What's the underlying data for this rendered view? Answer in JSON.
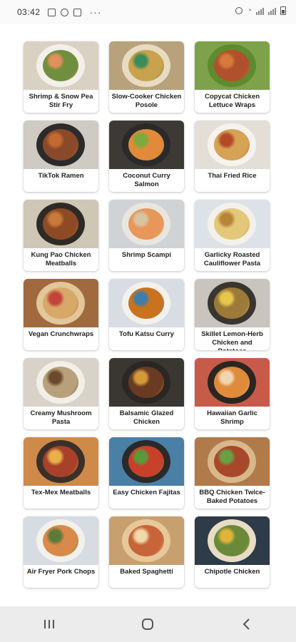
{
  "status_bar": {
    "time": "03:42",
    "more": "···"
  },
  "recipes": [
    {
      "title": "Shrimp & Snow Pea Stir Fry",
      "bg": "#d9d2c3",
      "plate": "#f3f0ea",
      "food": "#6f8f3c",
      "accent": "#e0905a"
    },
    {
      "title": "Slow-Cooker Chicken Posole",
      "bg": "#b7a27c",
      "plate": "#e7dcc1",
      "food": "#c8a24c",
      "accent": "#3d8a5a"
    },
    {
      "title": "Copycat Chicken Lettuce Wraps",
      "bg": "#7ea24a",
      "plate": "#5f8b2f",
      "food": "#b0502c",
      "accent": "#d57a3a"
    },
    {
      "title": "TikTok Ramen",
      "bg": "#cfcac2",
      "plate": "#2b2b2b",
      "food": "#8a4a2a",
      "accent": "#c26a32"
    },
    {
      "title": "Coconut Curry Salmon",
      "bg": "#3d3a36",
      "plate": "#2a2a2a",
      "food": "#e08a3a",
      "accent": "#7caa3c"
    },
    {
      "title": "Thai Fried Rice",
      "bg": "#e4dfd6",
      "plate": "#f6f3ee",
      "food": "#d6a254",
      "accent": "#b24a2a"
    },
    {
      "title": "Kung Pao Chicken Meatballs",
      "bg": "#cfc6b6",
      "plate": "#2e2a26",
      "food": "#8e4a24",
      "accent": "#c97a3a"
    },
    {
      "title": "Shrimp Scampi",
      "bg": "#cfd3d6",
      "plate": "#e9e6df",
      "food": "#e8965a",
      "accent": "#d8c4a0"
    },
    {
      "title": "Garlicky Roasted Cauliflower Pasta",
      "bg": "#dde2e8",
      "plate": "#f4f1ea",
      "food": "#e3c879",
      "accent": "#b8843a"
    },
    {
      "title": "Vegan Crunchwraps",
      "bg": "#a06a3e",
      "plate": "#e1c79a",
      "food": "#d7a868",
      "accent": "#c2443a"
    },
    {
      "title": "Tofu Katsu Curry",
      "bg": "#d7dde2",
      "plate": "#f3f1ec",
      "food": "#c9731f",
      "accent": "#3f7ea8"
    },
    {
      "title": "Skillet Lemon-Herb Chicken and Potatoes",
      "bg": "#c9c4bd",
      "plate": "#3a352f",
      "food": "#9c7a3a",
      "accent": "#e5c84a"
    },
    {
      "title": "Creamy Mushroom Pasta",
      "bg": "#d8d2c8",
      "plate": "#f2efe9",
      "food": "#b8a07a",
      "accent": "#6a4a2e"
    },
    {
      "title": "Balsamic Glazed Chicken",
      "bg": "#3a3632",
      "plate": "#2a2724",
      "food": "#6a3a22",
      "accent": "#d49a3a"
    },
    {
      "title": "Hawaiian Garlic Shrimp",
      "bg": "#c85a4a",
      "plate": "#2a2622",
      "food": "#e08a3c",
      "accent": "#f0d6b0"
    },
    {
      "title": "Tex-Mex Meatballs",
      "bg": "#cf8a4a",
      "plate": "#3a302a",
      "food": "#a8402a",
      "accent": "#e7b04a"
    },
    {
      "title": "Easy Chicken Fajitas",
      "bg": "#4a7fa6",
      "plate": "#2a2a2a",
      "food": "#c8402a",
      "accent": "#5a9a3a"
    },
    {
      "title": "BBQ Chicken Twice-Baked Potatoes",
      "bg": "#b07a4a",
      "plate": "#d8b88a",
      "food": "#a8482a",
      "accent": "#6aa044"
    },
    {
      "title": "Air Fryer Pork Chops",
      "bg": "#d7dce2",
      "plate": "#f3f1ec",
      "food": "#d98a4a",
      "accent": "#5c7a3a"
    },
    {
      "title": "Baked Spaghetti",
      "bg": "#c8a070",
      "plate": "#e6c89a",
      "food": "#c8643a",
      "accent": "#f0d8a8"
    },
    {
      "title": "Chipotle Chicken",
      "bg": "#2e3b48",
      "plate": "#e8dcc4",
      "food": "#6a8a3a",
      "accent": "#e0b43a"
    }
  ],
  "nav": {
    "recents": "recents",
    "home": "home",
    "back": "back"
  }
}
